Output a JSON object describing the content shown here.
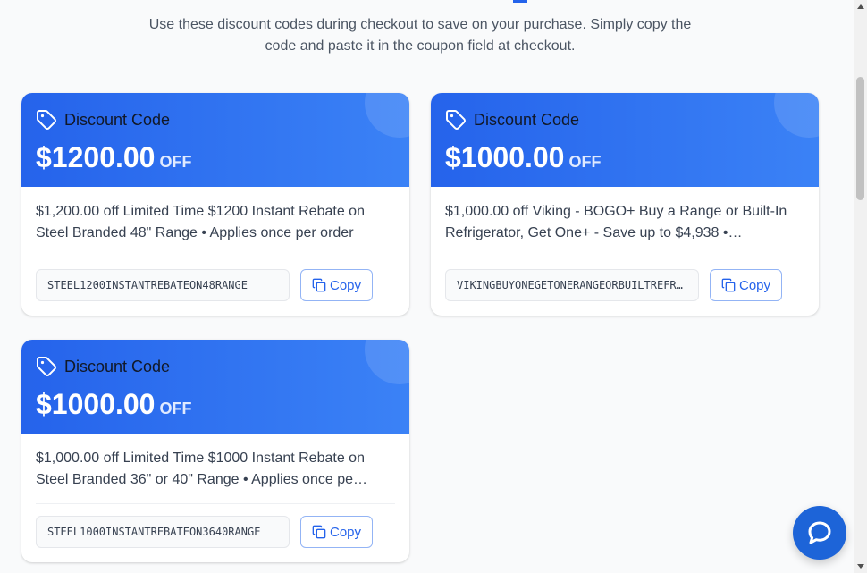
{
  "intro": {
    "line1": "Use these discount codes during checkout to save on your purchase. Simply copy the",
    "line2": "code and paste it in the coupon field at checkout."
  },
  "colors": {
    "accent": "#2563eb",
    "header_gradient_end": "#3b82f6",
    "chat_button": "#1d64d8"
  },
  "cards": [
    {
      "label": "Discount Code",
      "amount": "$1200.00",
      "off": "OFF",
      "description": "$1,200.00 off Limited Time $1200 Instant Rebate on Steel Branded 48\" Range • Applies once per order",
      "code": "STEEL1200INSTANTREBATEON48RANGE",
      "copy_label": "Copy",
      "icon": "tag-icon"
    },
    {
      "label": "Discount Code",
      "amount": "$1000.00",
      "off": "OFF",
      "description": "$1,000.00 off Viking - BOGO+ Buy a Range or Built-In Refrigerator, Get One+ - Save up to $4,938 •…",
      "code": "VIKINGBUYONEGETONERANGEORBUILTREFRI…",
      "copy_label": "Copy",
      "icon": "tag-icon"
    },
    {
      "label": "Discount Code",
      "amount": "$1000.00",
      "off": "OFF",
      "description": "$1,000.00 off Limited Time $1000 Instant Rebate on Steel Branded 36\" or 40\" Range • Applies once pe…",
      "code": "STEEL1000INSTANTREBATEON3640RANGE",
      "copy_label": "Copy",
      "icon": "tag-icon"
    }
  ],
  "chat": {
    "icon": "chat-bubble-icon"
  }
}
